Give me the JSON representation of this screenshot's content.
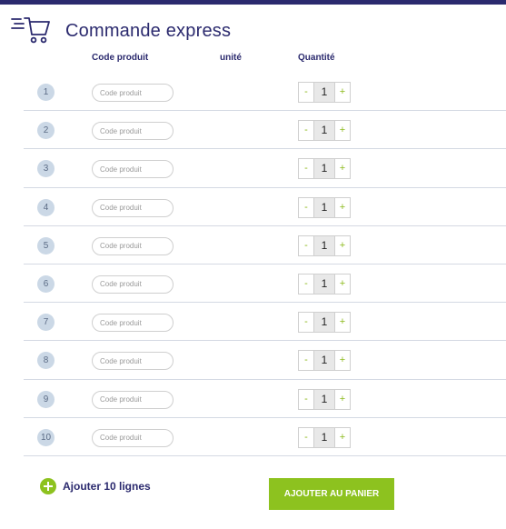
{
  "header": {
    "title": "Commande express",
    "icon": "express-cart-icon"
  },
  "columns": {
    "code": "Code produit",
    "unit": "unité",
    "quantity": "Quantité"
  },
  "rows": [
    {
      "number": "1",
      "code_placeholder": "Code produit",
      "quantity": "1"
    },
    {
      "number": "2",
      "code_placeholder": "Code produit",
      "quantity": "1"
    },
    {
      "number": "3",
      "code_placeholder": "Code produit",
      "quantity": "1"
    },
    {
      "number": "4",
      "code_placeholder": "Code produit",
      "quantity": "1"
    },
    {
      "number": "5",
      "code_placeholder": "Code produit",
      "quantity": "1"
    },
    {
      "number": "6",
      "code_placeholder": "Code produit",
      "quantity": "1"
    },
    {
      "number": "7",
      "code_placeholder": "Code produit",
      "quantity": "1"
    },
    {
      "number": "8",
      "code_placeholder": "Code produit",
      "quantity": "1"
    },
    {
      "number": "9",
      "code_placeholder": "Code produit",
      "quantity": "1"
    },
    {
      "number": "10",
      "code_placeholder": "Code produit",
      "quantity": "1"
    }
  ],
  "stepper": {
    "minus": "-",
    "plus": "+"
  },
  "footer": {
    "add_lines": "Ajouter 10 lignes",
    "add_to_cart": "AJOUTER AU PANIER"
  },
  "colors": {
    "navy": "#2b2a6e",
    "green": "#8dc21f",
    "badge": "#cbd8e6"
  }
}
